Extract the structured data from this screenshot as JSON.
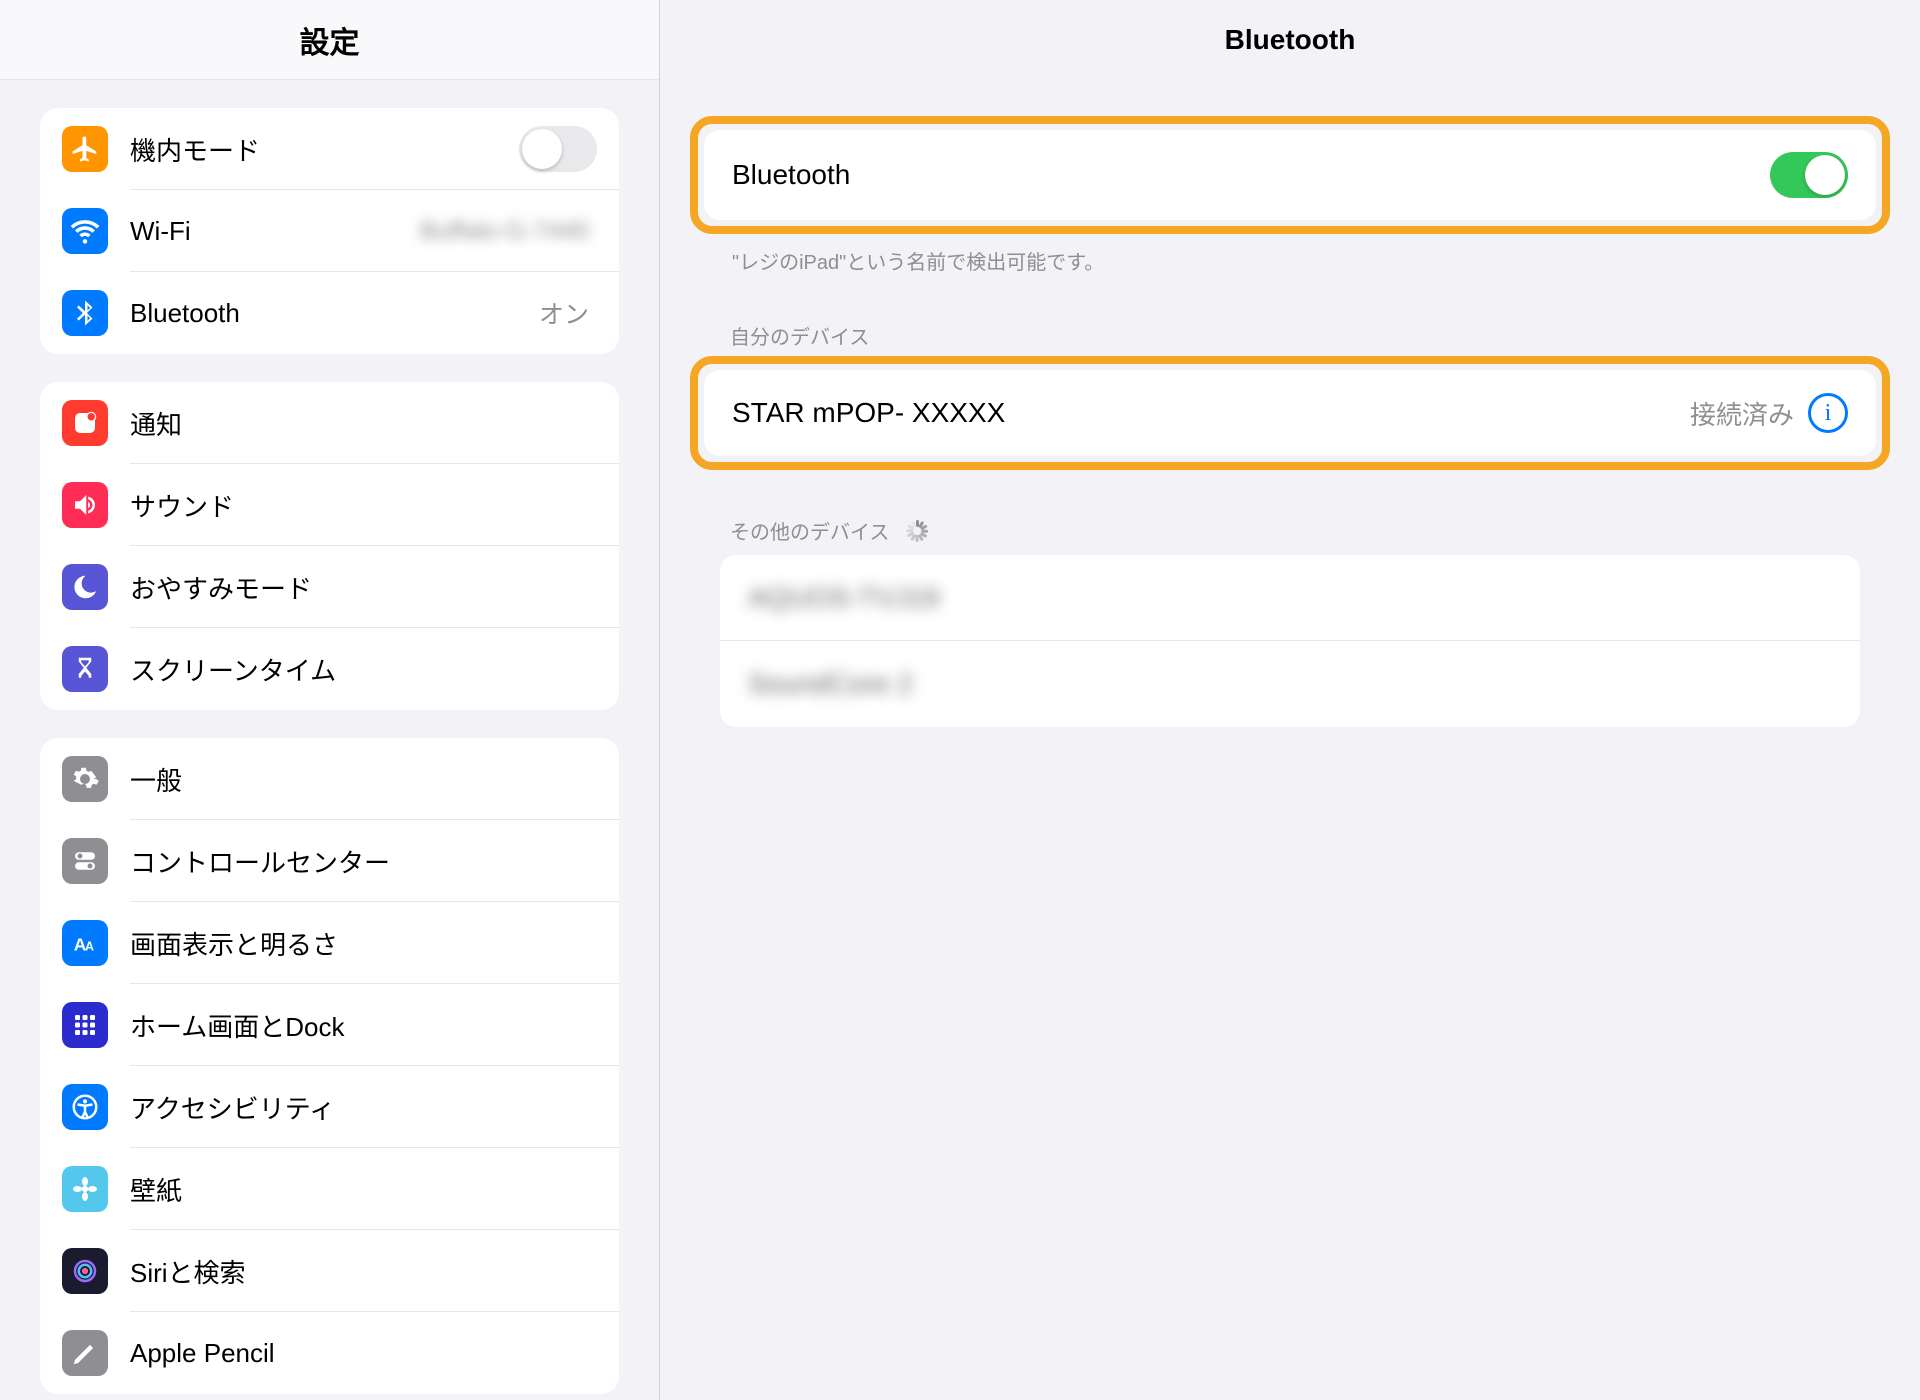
{
  "sidebar": {
    "title": "設定",
    "group1": [
      {
        "id": "airplane",
        "label": "機内モード",
        "iconBg": "#ff9500",
        "toggle": false
      },
      {
        "id": "wifi",
        "label": "Wi-Fi",
        "iconBg": "#007aff",
        "value": "Buffalo-G-7440",
        "blurValue": true
      },
      {
        "id": "bluetooth",
        "label": "Bluetooth",
        "iconBg": "#007aff",
        "value": "オン"
      }
    ],
    "group2": [
      {
        "id": "notifications",
        "label": "通知",
        "iconBg": "#ff3b30"
      },
      {
        "id": "sounds",
        "label": "サウンド",
        "iconBg": "#ff2d55"
      },
      {
        "id": "dnd",
        "label": "おやすみモード",
        "iconBg": "#5856d6"
      },
      {
        "id": "screentime",
        "label": "スクリーンタイム",
        "iconBg": "#5856d6"
      }
    ],
    "group3": [
      {
        "id": "general",
        "label": "一般",
        "iconBg": "#8e8e93"
      },
      {
        "id": "controlcenter",
        "label": "コントロールセンター",
        "iconBg": "#8e8e93"
      },
      {
        "id": "display",
        "label": "画面表示と明るさ",
        "iconBg": "#007aff"
      },
      {
        "id": "home",
        "label": "ホーム画面とDock",
        "iconBg": "#2c2cce"
      },
      {
        "id": "accessibility",
        "label": "アクセシビリティ",
        "iconBg": "#007aff"
      },
      {
        "id": "wallpaper",
        "label": "壁紙",
        "iconBg": "#54c7ec"
      },
      {
        "id": "siri",
        "label": "Siriと検索",
        "iconBg": "#1b1b2f"
      },
      {
        "id": "pencil",
        "label": "Apple Pencil",
        "iconBg": "#8e8e93"
      }
    ]
  },
  "main": {
    "title": "Bluetooth",
    "bt_toggle": {
      "label": "Bluetooth",
      "on": true
    },
    "discoverable_text": "\"レジのiPad\"という名前で検出可能です。",
    "my_devices": {
      "section_label": "自分のデバイス",
      "device": {
        "name": "STAR mPOP- XXXXX",
        "status": "接続済み"
      }
    },
    "other_devices": {
      "section_label": "その他のデバイス",
      "items": [
        {
          "name": "AQUOS-TVJ19"
        },
        {
          "name": "SoundCore 2"
        }
      ]
    }
  }
}
